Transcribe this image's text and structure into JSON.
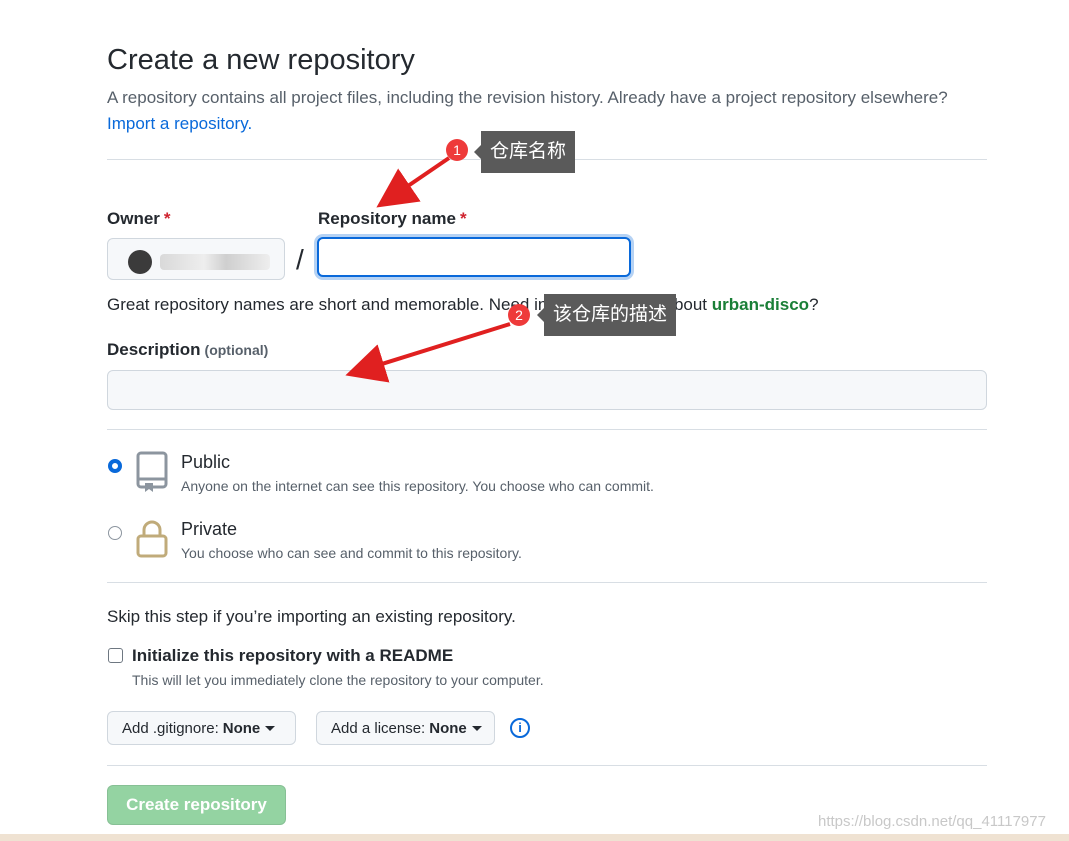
{
  "header": {
    "title": "Create a new repository",
    "subtitle": "A repository contains all project files, including the revision history. Already have a project repository elsewhere?",
    "import_link": "Import a repository."
  },
  "form": {
    "owner_label": "Owner",
    "required_mark": "*",
    "repo_label": "Repository name",
    "slash": "/",
    "repo_value": "",
    "name_hint_prefix": "Great repository names are short and memorable. Need inspiration? How about ",
    "name_suggestion": "urban-disco",
    "name_hint_suffix": "?",
    "description_label": "Description",
    "description_optional": "(optional)",
    "description_value": ""
  },
  "visibility": {
    "public_title": "Public",
    "public_desc": "Anyone on the internet can see this repository. You choose who can commit.",
    "private_title": "Private",
    "private_desc": "You choose who can see and commit to this repository.",
    "selected": "Public"
  },
  "init": {
    "skip_text": "Skip this step if you’re importing an existing repository.",
    "readme_label": "Initialize this repository with a README",
    "readme_desc": "This will let you immediately clone the repository to your computer.",
    "readme_checked": false,
    "gitignore_label": "Add .gitignore:",
    "gitignore_value": "None",
    "license_label": "Add a license:",
    "license_value": "None",
    "info_glyph": "i"
  },
  "create_button": "Create repository",
  "annotations": [
    {
      "number": "1",
      "text": "仓库名称"
    },
    {
      "number": "2",
      "text": "该仓库的描述"
    }
  ],
  "watermark": "https://blog.csdn.net/qq_41117977",
  "colors": {
    "link": "#0969da",
    "required": "#cf222e",
    "suggestion": "#1a7f37",
    "create_button_bg": "#94d3a2",
    "annotation_badge": "#ee3a3a",
    "annotation_tip": "#5a5a5a",
    "arrow": "#e02020"
  }
}
